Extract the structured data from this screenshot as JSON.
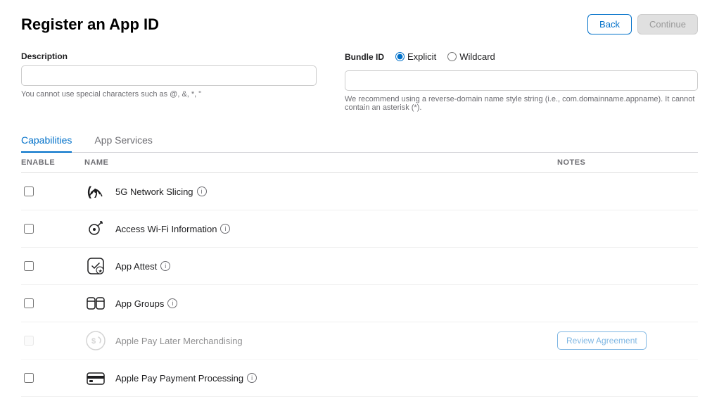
{
  "page": {
    "title": "Register an App ID"
  },
  "header": {
    "back_label": "Back",
    "continue_label": "Continue"
  },
  "description": {
    "label": "Description",
    "placeholder": "",
    "hint": "You cannot use special characters such as @, &, *, \""
  },
  "bundle_id": {
    "label": "Bundle ID",
    "explicit_label": "Explicit",
    "wildcard_label": "Wildcard",
    "placeholder": "",
    "hint": "We recommend using a reverse-domain name style string (i.e., com.domainname.appname). It cannot contain an asterisk (*)."
  },
  "tabs": [
    {
      "id": "capabilities",
      "label": "Capabilities",
      "active": true
    },
    {
      "id": "app-services",
      "label": "App Services",
      "active": false
    }
  ],
  "table": {
    "col_enable": "ENABLE",
    "col_name": "NAME",
    "col_notes": "NOTES"
  },
  "capabilities": [
    {
      "id": "5g-network-slicing",
      "name": "5G Network Slicing",
      "has_info": true,
      "has_review": false,
      "disabled": false,
      "icon": "5g"
    },
    {
      "id": "access-wifi-info",
      "name": "Access Wi-Fi Information",
      "has_info": true,
      "has_review": false,
      "disabled": false,
      "icon": "wifi"
    },
    {
      "id": "app-attest",
      "name": "App Attest",
      "has_info": true,
      "has_review": false,
      "disabled": false,
      "icon": "attest"
    },
    {
      "id": "app-groups",
      "name": "App Groups",
      "has_info": true,
      "has_review": false,
      "disabled": false,
      "icon": "groups"
    },
    {
      "id": "apple-pay-later",
      "name": "Apple Pay Later Merchandising",
      "has_info": false,
      "has_review": true,
      "review_label": "Review Agreement",
      "disabled": true,
      "icon": "pay-later"
    },
    {
      "id": "apple-pay-payment",
      "name": "Apple Pay Payment Processing",
      "has_info": true,
      "has_review": false,
      "disabled": false,
      "icon": "pay-processing"
    }
  ]
}
